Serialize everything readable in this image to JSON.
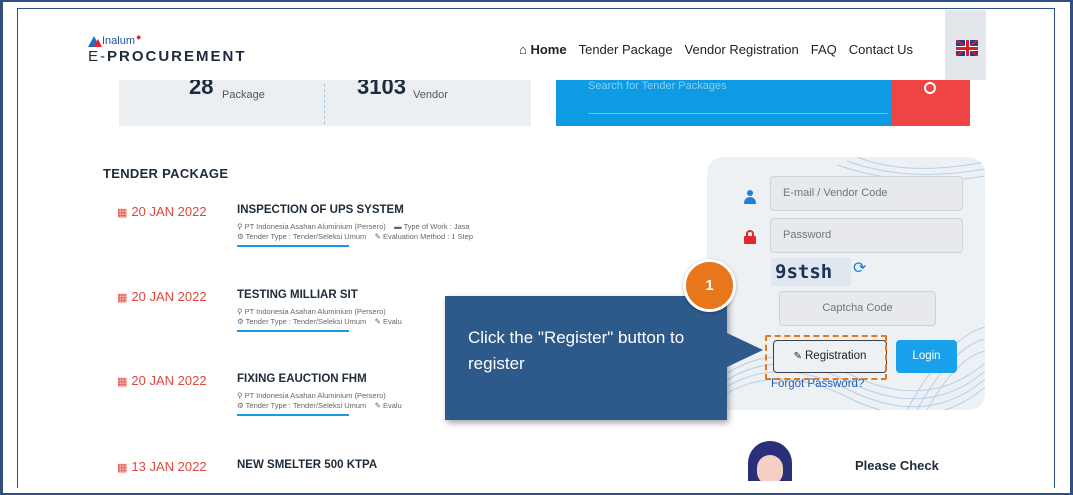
{
  "header": {
    "brand": "Inalum",
    "title_prefix": "E-",
    "title_bold": "PROCUREMENT",
    "nav": [
      {
        "label": "Home",
        "icon": "home-icon",
        "active": true
      },
      {
        "label": "Tender Package"
      },
      {
        "label": "Vendor Registration"
      },
      {
        "label": "FAQ"
      },
      {
        "label": "Contact Us"
      }
    ],
    "language_flag": "uk-flag-icon"
  },
  "stats": [
    {
      "value": "28",
      "label": "Package"
    },
    {
      "value": "3103",
      "label": "Vendor"
    }
  ],
  "search": {
    "placeholder": "Search for Tender Packages",
    "icon": "search-icon",
    "accent": "#0e9be3",
    "button_color": "#ef4444"
  },
  "tenders": {
    "heading": "TENDER PACKAGE",
    "items": [
      {
        "date": "20 JAN 2022",
        "title": "INSPECTION OF UPS SYSTEM",
        "company": "PT Indonesia Asahan Aluminium (Persero)",
        "work_type": "Type of Work : Jasa",
        "tender_type": "Tender Type : Tender/Seleksi Umum",
        "evaluation": "Evaluation Method : 1 Step"
      },
      {
        "date": "20 JAN 2022",
        "title": "TESTING MILLIAR SIT",
        "company": "PT Indonesia Asahan Aluminium (Persero)",
        "tender_type": "Tender Type : Tender/Seleksi Umum",
        "evaluation": "Evalu"
      },
      {
        "date": "20 JAN 2022",
        "title": "FIXING EAUCTION FHM",
        "company": "PT Indonesia Asahan Aluminium (Persero)",
        "tender_type": "Tender Type : Tender/Seleksi Umum",
        "evaluation": "Evalu"
      },
      {
        "date": "13 JAN 2022",
        "title": "NEW SMELTER 500 KTPA"
      }
    ]
  },
  "login": {
    "email_placeholder": "E-mail / Vendor Code",
    "password_placeholder": "Password",
    "captcha_text": "9stsh",
    "captcha_placeholder": "Captcha Code",
    "register_label": "Registration",
    "login_label": "Login",
    "forgot_label": "Forgot Password?"
  },
  "callout": {
    "step": "1",
    "text": "Click the \"Register\" button to register",
    "color": "#2e5a8b",
    "badge_color": "#e8761a"
  },
  "bottom": {
    "please_check": "Please Check"
  }
}
